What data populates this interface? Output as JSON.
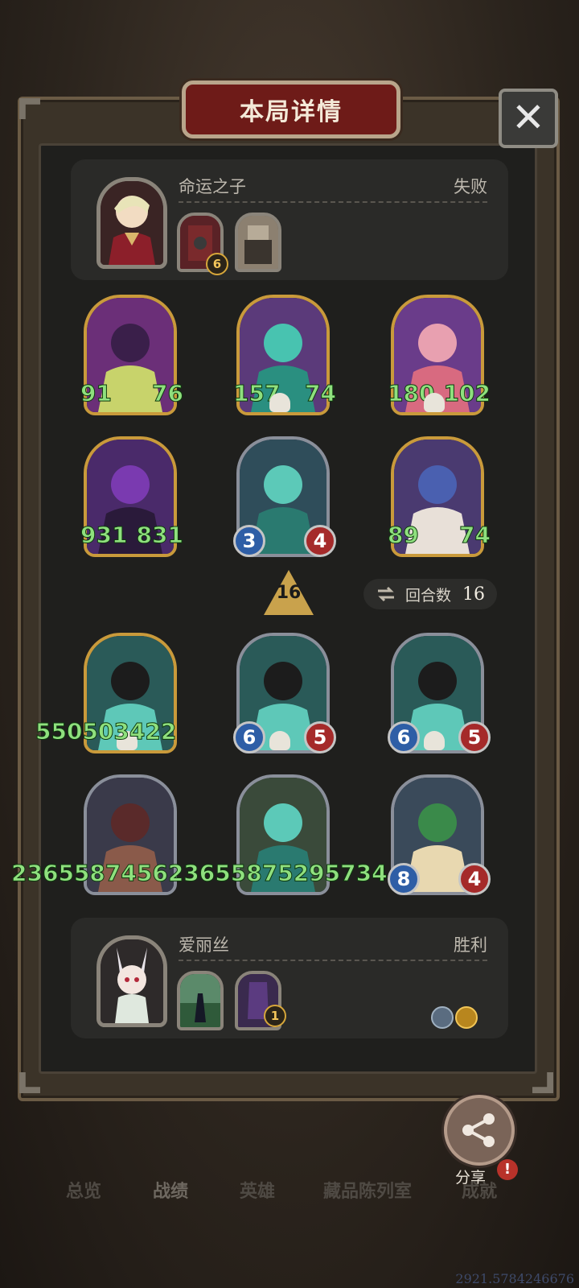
{
  "header": {
    "title": "本局详情",
    "close_glyph": "✕"
  },
  "top_player": {
    "name": "命运之子",
    "result": "失败",
    "relic_badges": [
      "6"
    ]
  },
  "bottom_player": {
    "name": "爱丽丝",
    "result": "胜利",
    "relic_badges": [
      "1"
    ]
  },
  "enemy_cards": [
    {
      "atk": "91",
      "hp": "76",
      "style": "green"
    },
    {
      "atk": "157",
      "hp": "74",
      "style": "green",
      "skull": true
    },
    {
      "atk": "180",
      "hp": "102",
      "style": "green",
      "skull": true
    },
    {
      "atk": "931",
      "hp": "831",
      "style": "green"
    },
    {
      "atk": "3",
      "hp": "4",
      "style": "orb"
    },
    {
      "atk": "89",
      "hp": "74",
      "style": "green"
    }
  ],
  "turn": {
    "arrow_value": "16",
    "label": "回合数",
    "value": "16"
  },
  "player_cards": [
    {
      "text": "550503422",
      "style": "green",
      "skull": true
    },
    {
      "atk": "6",
      "hp": "5",
      "style": "orb",
      "skull": true
    },
    {
      "atk": "6",
      "hp": "5",
      "style": "orb",
      "skull": true
    },
    {
      "text": "2365587456",
      "style": "green"
    },
    {
      "text": "2365587529",
      "style": "green"
    },
    {
      "atk": "8",
      "hp": "4",
      "style": "orb",
      "prefix": "573"
    }
  ],
  "row3_overlay": "550503422",
  "row4_overlay": "236558745623655875295734",
  "share": {
    "label": "分享",
    "alert": "!"
  },
  "tabs": [
    "总览",
    "战绩",
    "英雄",
    "藏品陈列室",
    "成就"
  ],
  "footer_number": "2921.5784246676"
}
